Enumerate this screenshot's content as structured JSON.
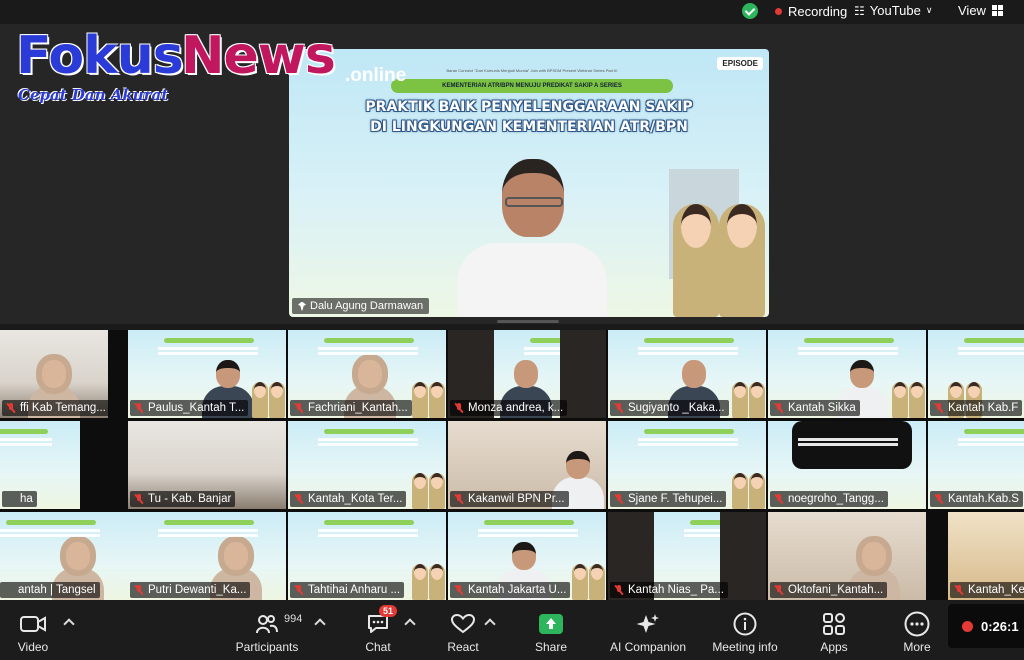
{
  "topbar": {
    "recording_label": "Recording",
    "youtube_label": "YouTube",
    "view_label": "View"
  },
  "logo": {
    "part1": "Fokus",
    "part2": "News",
    "suffix": ".online",
    "tagline": "Cepat Dan Akurat"
  },
  "slide": {
    "episode_badge": "EPISODE",
    "small_banner": "Baran Connect \"Dari Komunis Menjadi Mumia\" Join with BPSDM Present Webinar Series Part III",
    "green_banner": "KEMENTERIAN ATR/BPN MENUJU PREDIKAT SAKIP A SERIES",
    "title_line1": "PRAKTIK BAIK PENYELENGGARAAN SAKIP",
    "title_line2": "DI LINGKUNGAN KEMENTERIAN ATR/BPN"
  },
  "speaker": {
    "name": "Dalu Agung Darmawan"
  },
  "participants": [
    {
      "label": "ffi Kab Temang..."
    },
    {
      "label": "Paulus_Kantah T..."
    },
    {
      "label": "Fachriani_Kantah..."
    },
    {
      "label": "Monza andrea, k..."
    },
    {
      "label": "Sugiyanto _Kaka..."
    },
    {
      "label": "Kantah Sikka"
    },
    {
      "label": "Kantah Kab.F"
    },
    {
      "label": "ha"
    },
    {
      "label": "Tu - Kab. Banjar"
    },
    {
      "label": "Kantah_Kota Ter..."
    },
    {
      "label": "Kakanwil BPN Pr..."
    },
    {
      "label": "Sjane F. Tehupei..."
    },
    {
      "label": "noegroho_Tangg..."
    },
    {
      "label": "Kantah.Kab.S"
    },
    {
      "label": "antah | Tangsel"
    },
    {
      "label": "Putri Dewanti_Ka..."
    },
    {
      "label": "Tahtihai Anharu ..."
    },
    {
      "label": "Kantah Jakarta U..."
    },
    {
      "label": "Kantah Nias_ Pa..."
    },
    {
      "label": "Oktofani_Kantah..."
    },
    {
      "label": "Kantah_Kebu"
    }
  ],
  "toolbar": {
    "video": "Video",
    "participants": "Participants",
    "participant_count": "994",
    "chat": "Chat",
    "chat_badge": "51",
    "react": "React",
    "share": "Share",
    "ai_companion": "AI Companion",
    "meeting_info": "Meeting info",
    "apps": "Apps",
    "more": "More",
    "timer": "0:26:1"
  },
  "colors": {
    "recording_dot": "#e53935",
    "shield_green": "#2db55d",
    "share_green": "#2db55d",
    "logo_blue": "#2a3bd8",
    "logo_pink": "#c0175e"
  }
}
